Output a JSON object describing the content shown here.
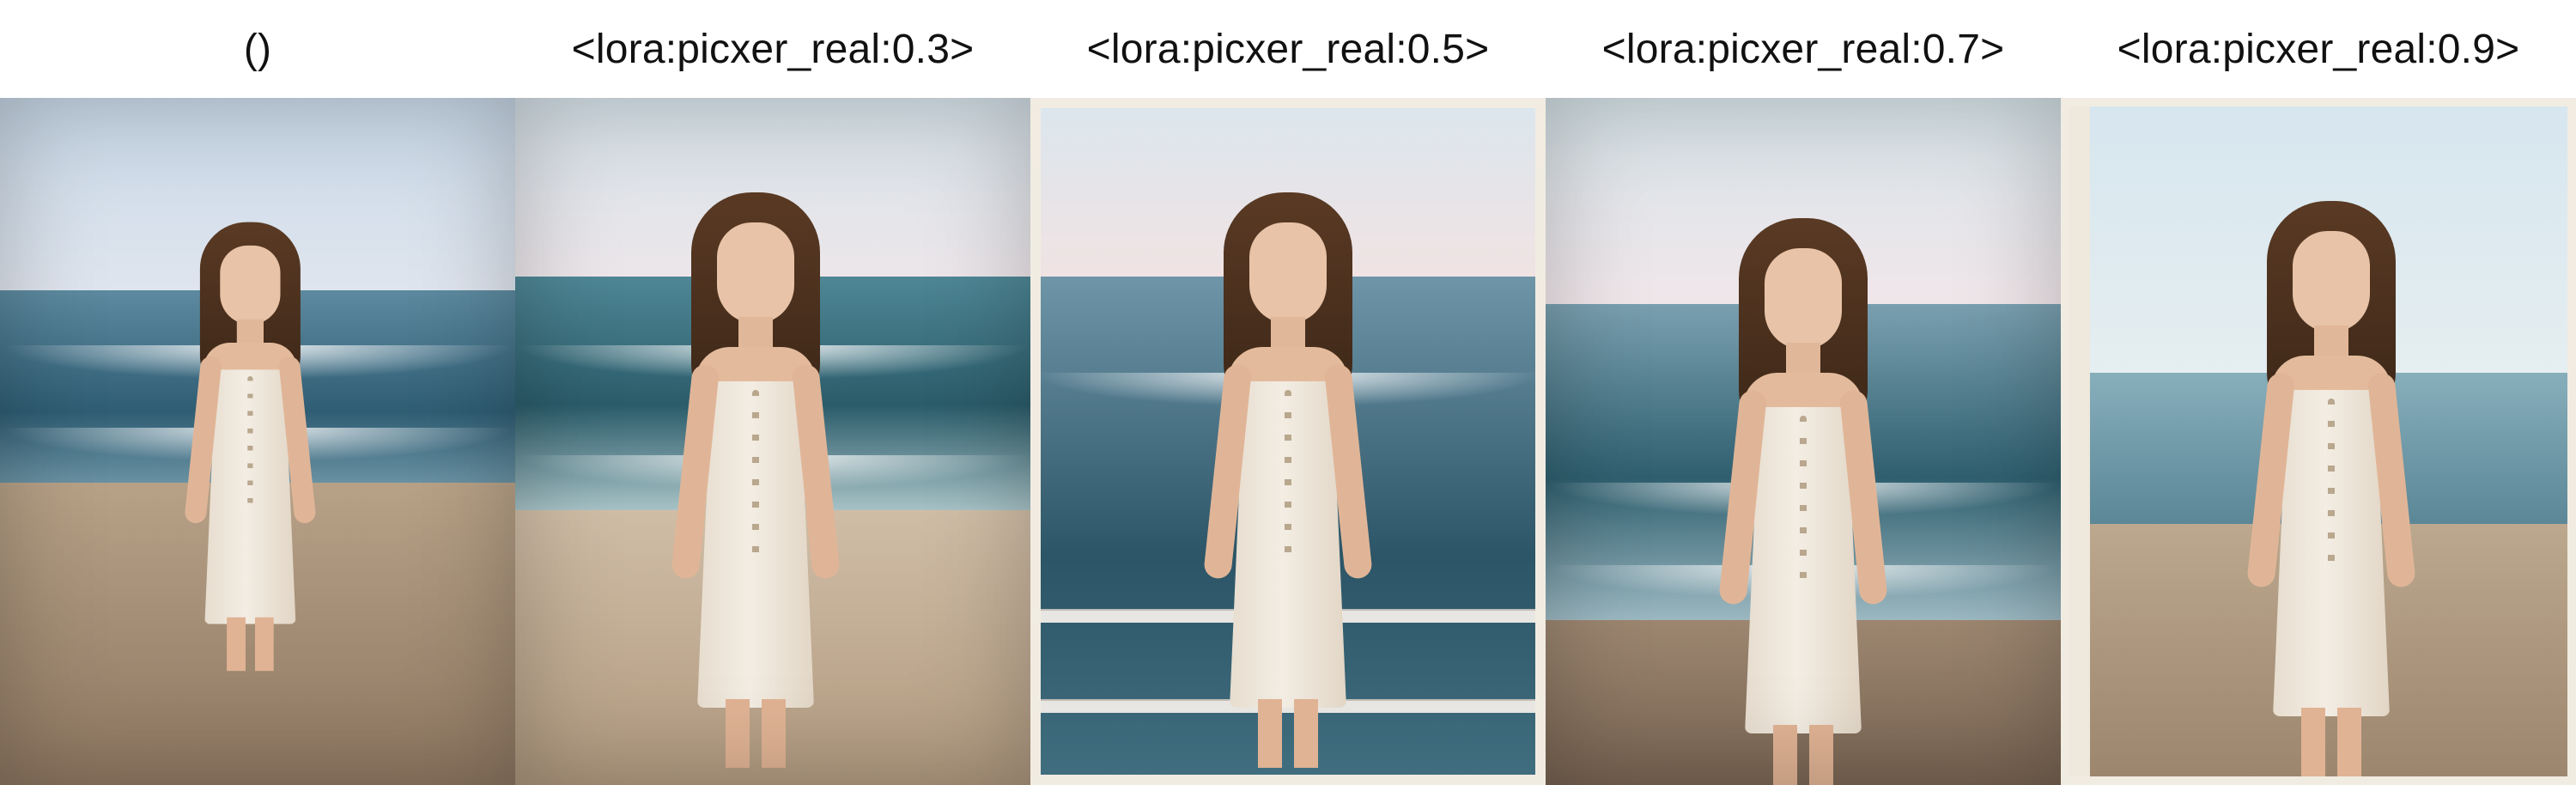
{
  "columns": [
    {
      "label": "()"
    },
    {
      "label": "<lora:picxer_real:0.3>"
    },
    {
      "label": "<lora:picxer_real:0.5>"
    },
    {
      "label": "<lora:picxer_real:0.7>"
    },
    {
      "label": "<lora:picxer_real:0.9>"
    }
  ]
}
